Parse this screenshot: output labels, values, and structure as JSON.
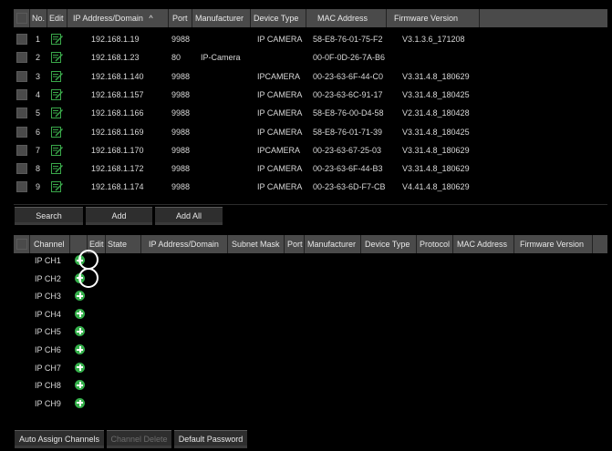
{
  "device_table": {
    "headers": {
      "no": "No.",
      "edit": "Edit",
      "ip": "IP Address/Domain",
      "sort_icon": "^",
      "port": "Port",
      "manufacturer": "Manufacturer",
      "device_type": "Device Type",
      "mac": "MAC Address",
      "firmware": "Firmware Version"
    },
    "rows": [
      {
        "no": "1",
        "ip": "192.168.1.19",
        "port": "9988",
        "manufacturer": "",
        "device_type": "IP CAMERA",
        "mac": "58-E8-76-01-75-F2",
        "firmware": "V3.1.3.6_171208"
      },
      {
        "no": "2",
        "ip": "192.168.1.23",
        "port": "80",
        "manufacturer": "IP-Camera",
        "device_type": "",
        "mac": "00-0F-0D-26-7A-B6",
        "firmware": ""
      },
      {
        "no": "3",
        "ip": "192.168.1.140",
        "port": "9988",
        "manufacturer": "",
        "device_type": "IPCAMERA",
        "mac": "00-23-63-6F-44-C0",
        "firmware": "V3.31.4.8_180629"
      },
      {
        "no": "4",
        "ip": "192.168.1.157",
        "port": "9988",
        "manufacturer": "",
        "device_type": "IP CAMERA",
        "mac": "00-23-63-6C-91-17",
        "firmware": "V3.31.4.8_180425"
      },
      {
        "no": "5",
        "ip": "192.168.1.166",
        "port": "9988",
        "manufacturer": "",
        "device_type": "IP CAMERA",
        "mac": "58-E8-76-00-D4-58",
        "firmware": "V2.31.4.8_180428"
      },
      {
        "no": "6",
        "ip": "192.168.1.169",
        "port": "9988",
        "manufacturer": "",
        "device_type": "IP CAMERA",
        "mac": "58-E8-76-01-71-39",
        "firmware": "V3.31.4.8_180425"
      },
      {
        "no": "7",
        "ip": "192.168.1.170",
        "port": "9988",
        "manufacturer": "",
        "device_type": "IPCAMERA",
        "mac": "00-23-63-67-25-03",
        "firmware": "V3.31.4.8_180629"
      },
      {
        "no": "8",
        "ip": "192.168.1.172",
        "port": "9988",
        "manufacturer": "",
        "device_type": "IP CAMERA",
        "mac": "00-23-63-6F-44-B3",
        "firmware": "V3.31.4.8_180629"
      },
      {
        "no": "9",
        "ip": "192.168.1.174",
        "port": "9988",
        "manufacturer": "",
        "device_type": "IP CAMERA",
        "mac": "00-23-63-6D-F7-CB",
        "firmware": "V4.41.4.8_180629"
      }
    ]
  },
  "buttons": {
    "search": "Search",
    "add": "Add",
    "add_all": "Add All",
    "auto_assign": "Auto Assign Channels",
    "channel_delete": "Channel Delete",
    "default_password": "Default Password"
  },
  "channel_table": {
    "headers": {
      "channel": "Channel",
      "edit": "Edit",
      "state": "State",
      "ip": "IP Address/Domain",
      "subnet": "Subnet Mask",
      "port": "Port",
      "manufacturer": "Manufacturer",
      "device_type": "Device Type",
      "protocol": "Protocol",
      "mac": "MAC Address",
      "firmware": "Firmware Version"
    },
    "channels": [
      "IP CH1",
      "IP CH2",
      "IP CH3",
      "IP CH4",
      "IP CH5",
      "IP CH6",
      "IP CH7",
      "IP CH8",
      "IP CH9"
    ],
    "add_icon": "plus-circle-icon",
    "highlighted": [
      "IP CH1",
      "IP CH2"
    ]
  },
  "colors": {
    "background": "#000000",
    "header": "#4a4a4a",
    "add_icon": "#35b04b",
    "edit_icon": "#3aa84a"
  }
}
